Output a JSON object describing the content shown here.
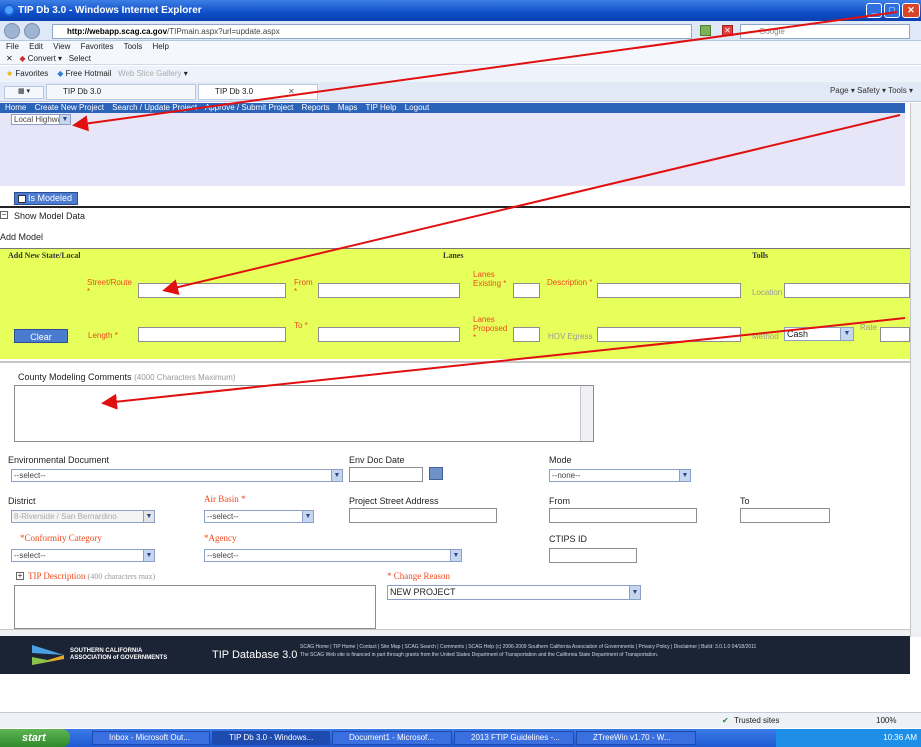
{
  "window": {
    "title": "TIP Db 3.0 - Windows Internet Explorer"
  },
  "browser": {
    "url_prefix": "http://webapp.scag.ca.gov",
    "url_rest": "/TIPmain.aspx?url=update.aspx",
    "search_placeholder": "Google",
    "menu": [
      "File",
      "Edit",
      "View",
      "Favorites",
      "Tools",
      "Help"
    ],
    "convert_label": "Convert",
    "select_label": "Select",
    "favorites_label": "Favorites",
    "hotmail_label": "Free Hotmail",
    "webslice_label": "Web Slice Gallery",
    "tab1": "TIP Db 3.0",
    "tab2": "TIP Db 3.0",
    "cmd": "Page ▾  Safety ▾  Tools ▾"
  },
  "appnav": [
    "Home",
    "Create New Project",
    "Search / Update Project",
    "Approve / Submit Project",
    "Reports",
    "Maps",
    "TIP Help",
    "Logout"
  ],
  "program_select": "Local Highway",
  "is_modeled_label": "Is Modeled",
  "show_model_data": "Show Model Data",
  "add_model": "Add Model",
  "green": {
    "section_title": "Add New State/Local",
    "lanes_title": "Lanes",
    "tolls_title": "Tolls",
    "street_route": "Street/Route *",
    "from": "From *",
    "lanes_existing": "Lanes Existing *",
    "description": "Description *",
    "location": "Location",
    "clear": "Clear",
    "length": "Length *",
    "to": "To *",
    "lanes_proposed": "Lanes Proposed *",
    "hov_egress": "HOV Egress",
    "method": "Method",
    "method_value": "Cash",
    "rate": "Rate"
  },
  "comments": {
    "label": "County Modeling Comments",
    "hint": "(4000 Characters Maximum)"
  },
  "form": {
    "env_doc": "Environmental Document",
    "env_doc_value": "--select--",
    "env_doc_date": "Env Doc Date",
    "mode": "Mode",
    "mode_value": "--none--",
    "district": "District",
    "district_value": "8-Riverside / San Bernardino",
    "air_basin": "Air Basin *",
    "air_basin_value": "--select--",
    "street_address": "Project Street Address",
    "from": "From",
    "to": "To",
    "conformity": "*Conformity Category",
    "conformity_value": "--select--",
    "agency": "*Agency",
    "agency_value": "--select--",
    "ctips": "CTIPS ID",
    "tip_desc": "TIP Description",
    "tip_desc_hint": "(400 characters max)",
    "change_reason": "* Change Reason",
    "change_reason_value": "NEW PROJECT"
  },
  "footer": {
    "org1": "SOUTHERN CALIFORNIA",
    "org2": "ASSOCIATION of GOVERNMENTS",
    "product": "TIP Database 3.0",
    "copyright": "SCAG Home | TIP Home | Contact | Site Map | SCAG Search | Comments | SCAG Help (c) 2006-2009 Southern California Association of Governments | Privacy Policy | Disclaimer | Build: 3.0.1.0 04/18/2011",
    "funding": "The SCAG Web site is financed in part through grants from the United States Department of Transportation and the California State Department of Transportation."
  },
  "status": {
    "zone": "Trusted sites",
    "zoom": "100%"
  },
  "taskbar": {
    "start": "start",
    "items": [
      "Inbox - Microsoft Out...",
      "TIP Db 3.0 - Windows...",
      "Document1 - Microsof...",
      "2013 FTIP Guidelines -...",
      "ZTreeWin v1.70 - W..."
    ],
    "time": "10:36 AM"
  },
  "colors": {
    "nav": "#2b63b8",
    "green": "#e6ff5a",
    "arrow": "#e01010",
    "label_red": "#f04a1e"
  }
}
